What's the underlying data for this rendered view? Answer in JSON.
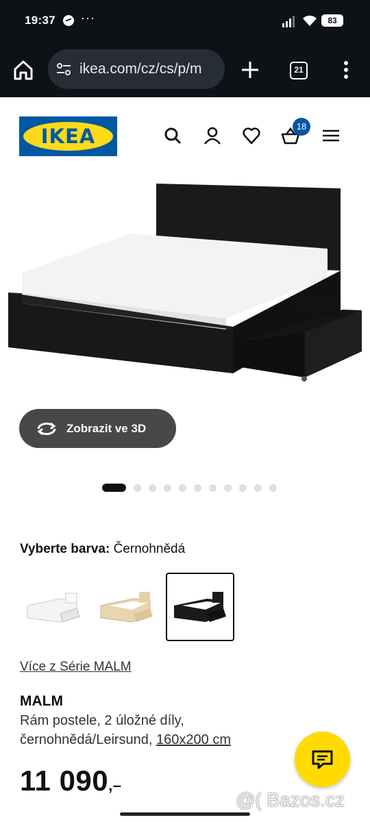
{
  "status_bar": {
    "time": "19:37",
    "overflow": "···",
    "battery": "83"
  },
  "browser": {
    "url": "ikea.com/cz/cs/p/m",
    "tab_count": "21"
  },
  "header": {
    "logo_text": "IKEA",
    "cart_count": "18",
    "icons": [
      "search-icon",
      "account-icon",
      "heart-icon",
      "cart-icon",
      "hamburger-icon"
    ]
  },
  "product": {
    "view3d_label": "Zobrazit ve 3D",
    "carousel": {
      "count": 11,
      "active_index": 0
    },
    "color_prompt": "Vyberte barva:",
    "color_value": "Černohnědá",
    "swatches": [
      {
        "name": "white",
        "selected": false
      },
      {
        "name": "oak",
        "selected": false
      },
      {
        "name": "black-brown",
        "selected": true
      }
    ],
    "series_link": "Více z Série MALM",
    "name": "MALM",
    "desc_line1": "Rám postele, 2 úložné díly,",
    "desc_line2": "černohnědá/Leirsund,",
    "size": "160x200 cm",
    "price": "11 090",
    "price_suffix": ",–"
  },
  "watermark": "@( Bazos.cz",
  "colors": {
    "ikea_blue": "#0058a3",
    "ikea_yellow": "#ffda1a",
    "chat_yellow": "#ffdb00",
    "browser_dark": "#0e1116"
  }
}
